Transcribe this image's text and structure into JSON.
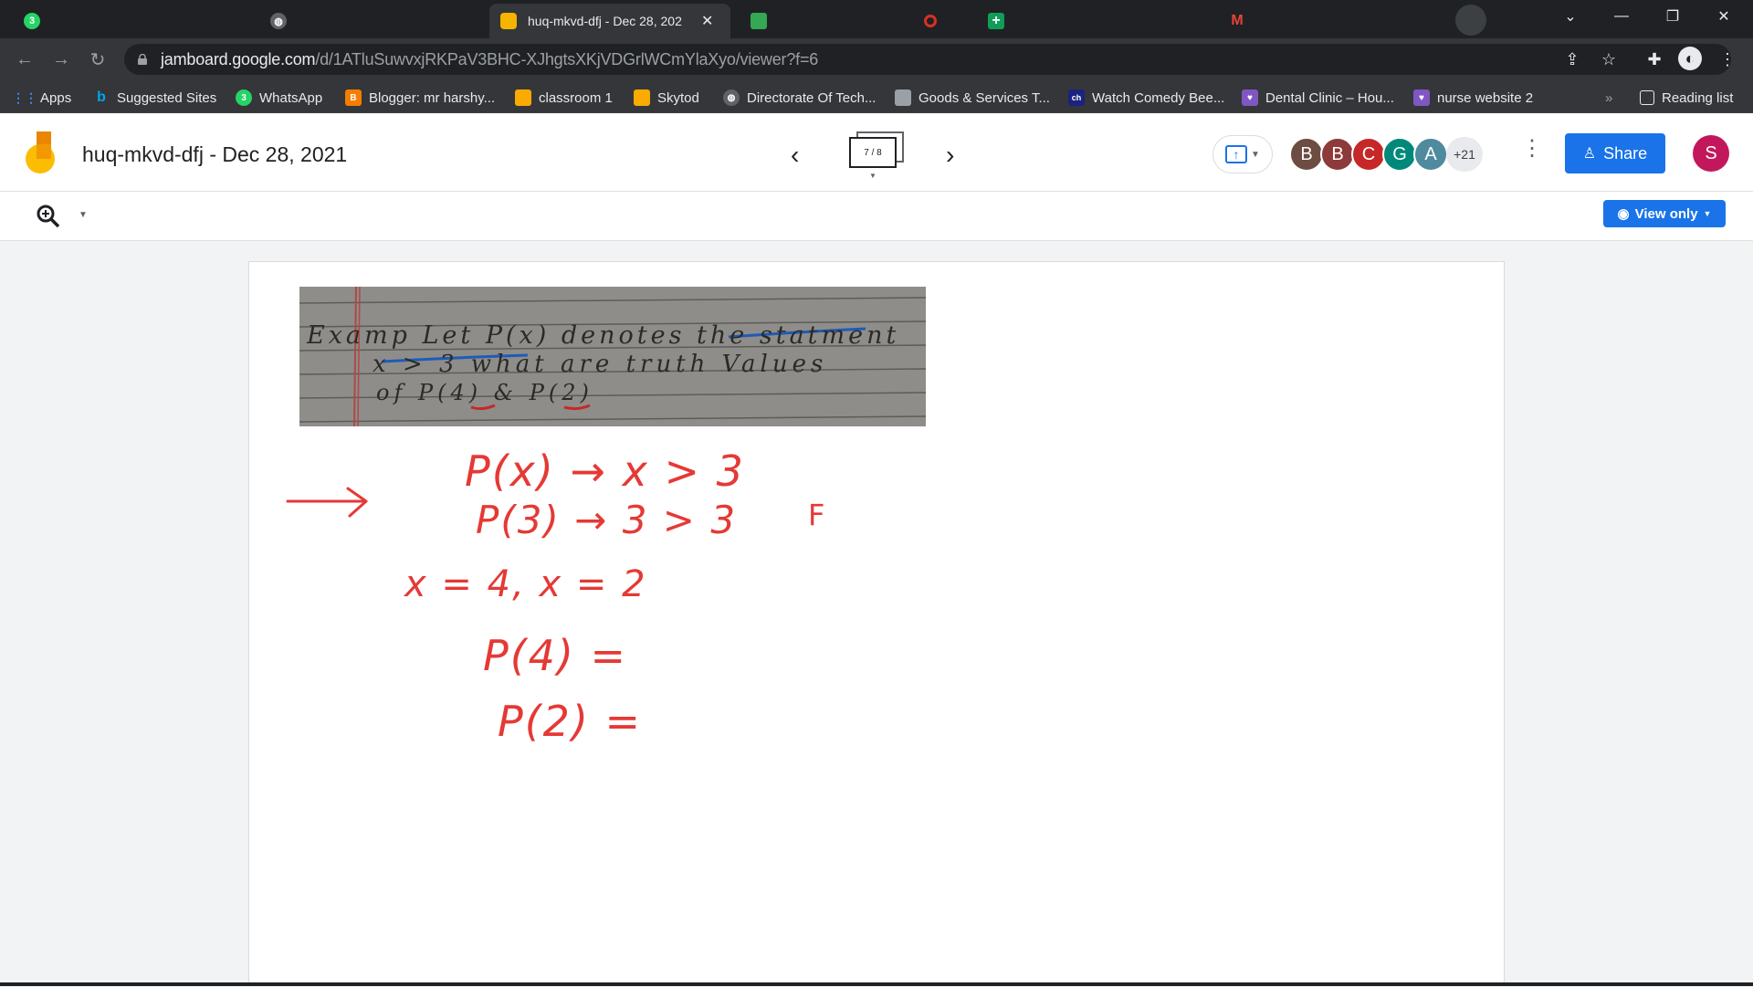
{
  "browser": {
    "tabs": [
      {
        "title": "",
        "favicon": "whatsapp-icon",
        "badge": "3"
      },
      {
        "title": "",
        "favicon": "globe-icon"
      },
      {
        "title": "huq-mkvd-dfj - Dec 28, 202",
        "favicon": "jamboard-icon",
        "active": true
      },
      {
        "title": "",
        "favicon": "meet-icon"
      },
      {
        "title": "",
        "favicon": "record-icon"
      },
      {
        "title": "",
        "favicon": "sheets-plus-icon"
      },
      {
        "title": "",
        "favicon": "gmail-icon"
      }
    ],
    "url_host": "jamboard.google.com",
    "url_path": "/d/1ATluSuwvxjRKPaV3BHC-XJhgtsXKjVDGrlWCmYlaXyo/viewer?f=6"
  },
  "bookmarks": {
    "items": [
      {
        "label": "Apps",
        "icon": "apps-grid-icon"
      },
      {
        "label": "Suggested Sites",
        "icon": "bing-icon"
      },
      {
        "label": "WhatsApp",
        "icon": "whatsapp-icon"
      },
      {
        "label": "Blogger: mr harshy...",
        "icon": "blogger-icon"
      },
      {
        "label": "classroom 1",
        "icon": "classroom-icon"
      },
      {
        "label": "Skytod",
        "icon": "skytod-icon"
      },
      {
        "label": "Directorate Of Tech...",
        "icon": "globe-icon"
      },
      {
        "label": "Goods & Services T...",
        "icon": "gst-icon"
      },
      {
        "label": "Watch Comedy Bee...",
        "icon": "ch-icon"
      },
      {
        "label": "Dental Clinic – Hou...",
        "icon": "heart-icon"
      },
      {
        "label": "nurse website 2",
        "icon": "heart-icon"
      }
    ],
    "overflow": "»",
    "reading_list": "Reading list"
  },
  "jamboard": {
    "doc_title": "huq-mkvd-dfj - Dec 28, 2021",
    "frame_indicator": "7 / 8",
    "collaborators": [
      {
        "initial": "B",
        "color": "#6d4c41"
      },
      {
        "initial": "B",
        "color": "#8d3a3a"
      },
      {
        "initial": "C",
        "color": "#c62828"
      },
      {
        "initial": "G",
        "color": "#00897b"
      },
      {
        "initial": "A",
        "color": "#4f8a9f"
      }
    ],
    "more_collaborators": "+21",
    "share_label": "Share",
    "user_initial": "S",
    "view_only_label": "View only"
  },
  "canvas": {
    "photo_text": {
      "line1": "Examp Let P(x) denotes the statment",
      "line2": "x > 3 what are truth Values",
      "line3": "of P(4) & P(2)"
    },
    "handwriting": {
      "line1": "P(x) → x > 3",
      "line2": "P(3) → 3 > 3",
      "mark_f": "F",
      "line3": "x = 4,  x = 2",
      "line4": "P(4) =",
      "line5": "P(2) ="
    },
    "ink_color": "#e53935"
  }
}
